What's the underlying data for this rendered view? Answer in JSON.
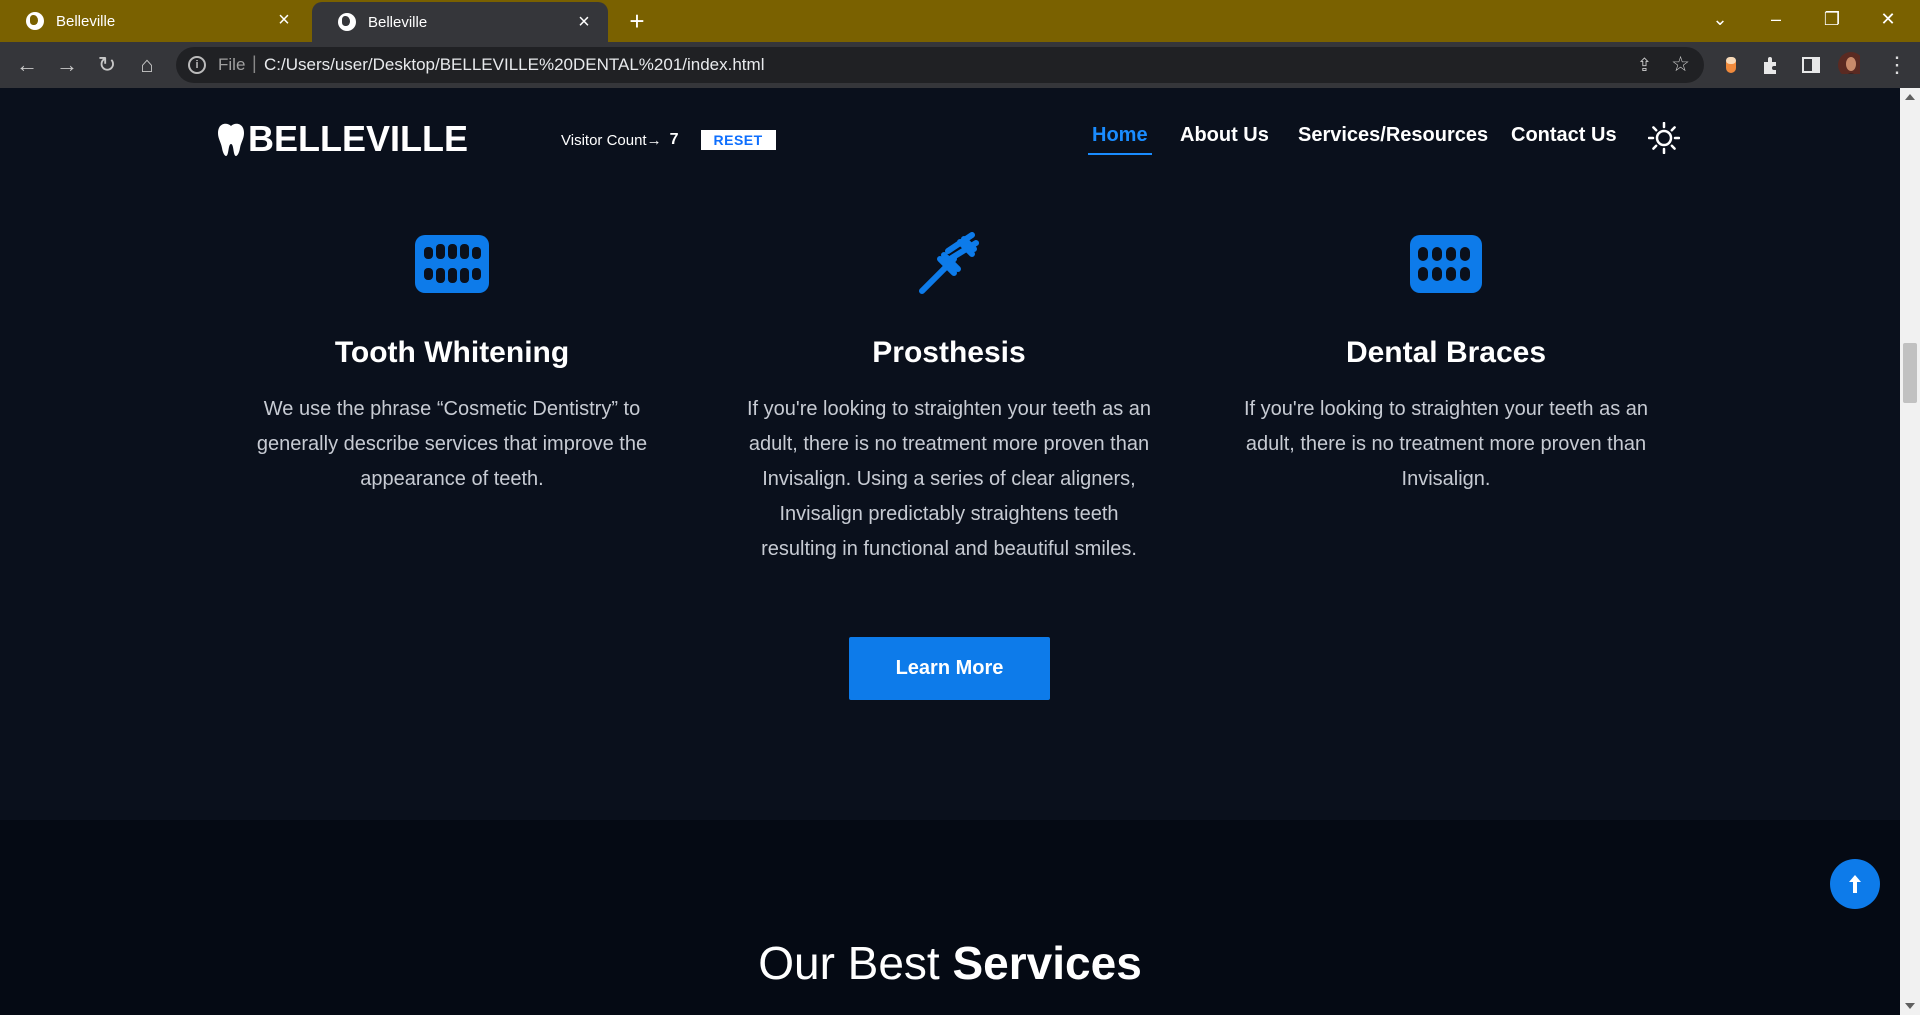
{
  "browser": {
    "tabs": [
      {
        "title": "Belleville",
        "active": false
      },
      {
        "title": "Belleville",
        "active": true
      }
    ],
    "new_tab_label": "+",
    "address": {
      "scheme_label": "File",
      "url": "C:/Users/user/Desktop/BELLEVILLE%20DENTAL%201/index.html"
    },
    "colors": {
      "tabbar": "#7a6100",
      "toolbar": "#35363a"
    }
  },
  "header": {
    "logo_text": "BELLEVILLE",
    "visitor_label": "Visitor Count→",
    "visitor_count": "7",
    "reset_label": "RESET",
    "nav": [
      {
        "label": "Home",
        "active": true
      },
      {
        "label": "About Us",
        "active": false
      },
      {
        "label": "Services/Resources",
        "active": false
      },
      {
        "label": "Contact Us",
        "active": false
      }
    ],
    "theme_toggle_icon": "sun-icon"
  },
  "cards": [
    {
      "icon": "teeth-icon",
      "title": "Tooth Whitening",
      "text": "We use the phrase “Cosmetic Dentistry” to generally describe services that improve the appearance of teeth."
    },
    {
      "icon": "crutch-icon",
      "title": "Prosthesis",
      "text": "If you're looking to straighten your teeth as an adult, there is no treatment more proven than Invisalign. Using a series of clear aligners, Invisalign predictably straightens teeth resulting in functional and beautiful smiles."
    },
    {
      "icon": "teeth-open-icon",
      "title": "Dental Braces",
      "text": "If you're looking to straighten your teeth as an adult, there is no treatment more proven than Invisalign."
    }
  ],
  "learn_more_label": "Learn More",
  "best_services": {
    "prefix": "Our Best",
    "bold": "Services"
  },
  "accent_color": "#0d7bea"
}
